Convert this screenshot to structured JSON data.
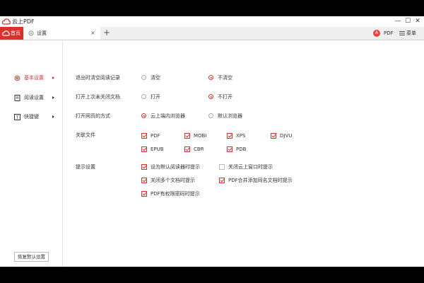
{
  "app": {
    "title": "云上PDF"
  },
  "window_controls": {
    "minimize": "—",
    "maximize": "☐",
    "close": "✕"
  },
  "tabs": {
    "home": "首页",
    "settings": "设置",
    "close": "×",
    "new": "+"
  },
  "toolbar": {
    "badge": "A",
    "pdf": "PDF",
    "menu": "菜单"
  },
  "sidebar": {
    "items": [
      {
        "label": "基本设置",
        "active": true
      },
      {
        "label": "阅读设置",
        "active": false
      },
      {
        "label": "快捷键",
        "active": false
      }
    ],
    "restore_button": "恢复默认设置"
  },
  "settings": {
    "clear_history": {
      "label": "退出时清空阅读记录",
      "options": [
        {
          "label": "清空",
          "selected": false
        },
        {
          "label": "不清空",
          "selected": true
        }
      ]
    },
    "open_last": {
      "label": "打开上次未关闭文档",
      "options": [
        {
          "label": "打开",
          "selected": false
        },
        {
          "label": "不打开",
          "selected": true
        }
      ]
    },
    "open_web": {
      "label": "打开网页的方式",
      "options": [
        {
          "label": "云上端内浏览器",
          "selected": true
        },
        {
          "label": "默认浏览器",
          "selected": false
        }
      ]
    },
    "assoc": {
      "label": "关联文件",
      "types": [
        {
          "label": "PDF",
          "checked": true
        },
        {
          "label": "MOBI",
          "checked": true
        },
        {
          "label": "XPS",
          "checked": true
        },
        {
          "label": "DJVU",
          "checked": true
        },
        {
          "label": "EPUB",
          "checked": true
        },
        {
          "label": "CBR",
          "checked": true
        },
        {
          "label": "PDB",
          "checked": true
        }
      ]
    },
    "prompts": {
      "label": "提示设置",
      "items": [
        {
          "label": "设为默认阅读器时提示",
          "checked": true
        },
        {
          "label": "关闭云上窗口时提示",
          "checked": false
        },
        {
          "label": "关闭多个文档时提示",
          "checked": true
        },
        {
          "label": "PDF合并添加同名文档时提示",
          "checked": true
        },
        {
          "label": "PDF有权限密码时提示",
          "checked": true
        }
      ]
    }
  },
  "colors": {
    "accent": "#d9322c"
  }
}
